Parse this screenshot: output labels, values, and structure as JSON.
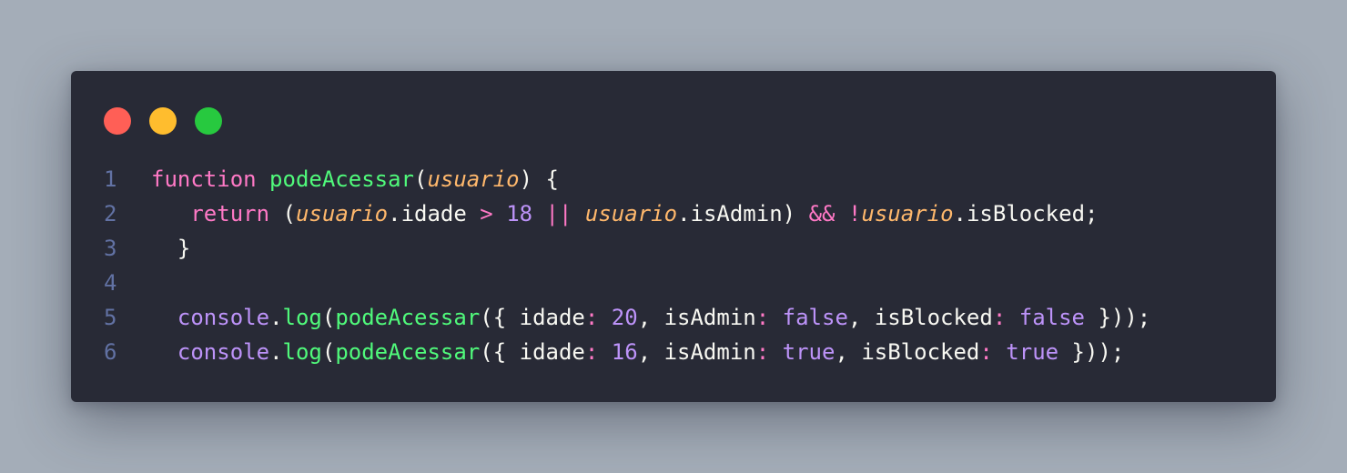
{
  "window": {
    "dots": [
      "close",
      "minimize",
      "maximize"
    ]
  },
  "code": {
    "lines": [
      {
        "number": "1",
        "indent": "",
        "tokens": [
          {
            "t": "function",
            "c": "kw"
          },
          {
            "t": " ",
            "c": "plain"
          },
          {
            "t": "podeAcessar",
            "c": "fn"
          },
          {
            "t": "(",
            "c": "plain"
          },
          {
            "t": "usuario",
            "c": "param"
          },
          {
            "t": ") {",
            "c": "plain"
          }
        ]
      },
      {
        "number": "2",
        "indent": "   ",
        "tokens": [
          {
            "t": "return",
            "c": "kw"
          },
          {
            "t": " (",
            "c": "plain"
          },
          {
            "t": "usuario",
            "c": "param"
          },
          {
            "t": ".idade ",
            "c": "plain"
          },
          {
            "t": ">",
            "c": "op"
          },
          {
            "t": " ",
            "c": "plain"
          },
          {
            "t": "18",
            "c": "num"
          },
          {
            "t": " ",
            "c": "plain"
          },
          {
            "t": "||",
            "c": "op"
          },
          {
            "t": " ",
            "c": "plain"
          },
          {
            "t": "usuario",
            "c": "param"
          },
          {
            "t": ".isAdmin) ",
            "c": "plain"
          },
          {
            "t": "&&",
            "c": "op"
          },
          {
            "t": " ",
            "c": "plain"
          },
          {
            "t": "!",
            "c": "op"
          },
          {
            "t": "usuario",
            "c": "param"
          },
          {
            "t": ".isBlocked;",
            "c": "plain"
          }
        ]
      },
      {
        "number": "3",
        "indent": " ",
        "tokens": [
          {
            "t": " }",
            "c": "plain"
          }
        ]
      },
      {
        "number": "4",
        "indent": "",
        "tokens": []
      },
      {
        "number": "5",
        "indent": "  ",
        "tokens": [
          {
            "t": "console",
            "c": "obj"
          },
          {
            "t": ".",
            "c": "plain"
          },
          {
            "t": "log",
            "c": "fn"
          },
          {
            "t": "(",
            "c": "plain"
          },
          {
            "t": "podeAcessar",
            "c": "fn"
          },
          {
            "t": "({ idade",
            "c": "plain"
          },
          {
            "t": ":",
            "c": "op"
          },
          {
            "t": " ",
            "c": "plain"
          },
          {
            "t": "20",
            "c": "num"
          },
          {
            "t": ", isAdmin",
            "c": "plain"
          },
          {
            "t": ":",
            "c": "op"
          },
          {
            "t": " ",
            "c": "plain"
          },
          {
            "t": "false",
            "c": "bool"
          },
          {
            "t": ", isBlocked",
            "c": "plain"
          },
          {
            "t": ":",
            "c": "op"
          },
          {
            "t": " ",
            "c": "plain"
          },
          {
            "t": "false",
            "c": "bool"
          },
          {
            "t": " }));",
            "c": "plain"
          }
        ]
      },
      {
        "number": "6",
        "indent": "  ",
        "tokens": [
          {
            "t": "console",
            "c": "obj"
          },
          {
            "t": ".",
            "c": "plain"
          },
          {
            "t": "log",
            "c": "fn"
          },
          {
            "t": "(",
            "c": "plain"
          },
          {
            "t": "podeAcessar",
            "c": "fn"
          },
          {
            "t": "({ idade",
            "c": "plain"
          },
          {
            "t": ":",
            "c": "op"
          },
          {
            "t": " ",
            "c": "plain"
          },
          {
            "t": "16",
            "c": "num"
          },
          {
            "t": ", isAdmin",
            "c": "plain"
          },
          {
            "t": ":",
            "c": "op"
          },
          {
            "t": " ",
            "c": "plain"
          },
          {
            "t": "true",
            "c": "bool"
          },
          {
            "t": ", isBlocked",
            "c": "plain"
          },
          {
            "t": ":",
            "c": "op"
          },
          {
            "t": " ",
            "c": "plain"
          },
          {
            "t": "true",
            "c": "bool"
          },
          {
            "t": " }));",
            "c": "plain"
          }
        ]
      }
    ]
  }
}
